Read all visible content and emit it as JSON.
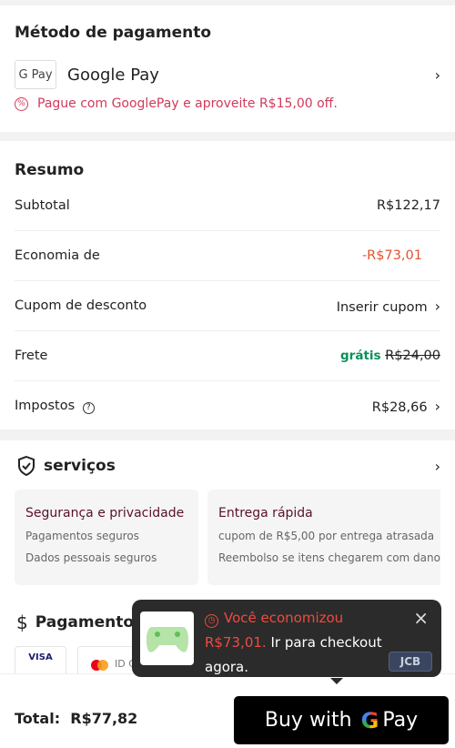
{
  "payment": {
    "title": "Método de pagamento",
    "method": "Google Pay",
    "badge": "G Pay",
    "promo": "Pague com GooglePay e aproveite R$15,00 off."
  },
  "summary": {
    "title": "Resumo",
    "rows": [
      {
        "label": "Subtotal",
        "value": "R$122,17"
      },
      {
        "label": "Economia de",
        "value": "-R$73,01"
      },
      {
        "label": "Cupom de desconto",
        "value": "Inserir cupom"
      },
      {
        "label": "Frete",
        "value": "grátis",
        "old": "R$24,00"
      },
      {
        "label": "Impostos",
        "value": "R$28,66"
      }
    ]
  },
  "services": {
    "title": "serviços",
    "cards": [
      {
        "title": "Segurança e privacidade",
        "lines": [
          "Pagamentos seguros",
          "Dados pessoais seguros"
        ]
      },
      {
        "title": "Entrega rápida",
        "lines": [
          "cupom de R$5,00 por entrega atrasada",
          "Reembolso se itens chegarem com danos"
        ]
      }
    ]
  },
  "secure_payments": {
    "title": "Pagamentos seguros",
    "logos": [
      "VISA",
      "ID Check",
      "JCB"
    ]
  },
  "tooltip": {
    "line1": "Você economizou",
    "amount": "R$73,01.",
    "rest": "Ir para checkout agora."
  },
  "footer": {
    "total_label": "Total:",
    "total": "R$77,82",
    "buy_label": "Buy with",
    "pay": "Pay"
  },
  "colors": {
    "promo": "#d2395b",
    "savings": "#e0532f",
    "free": "#0a8f5a",
    "tooltip_bg": "#2b2b2b"
  }
}
